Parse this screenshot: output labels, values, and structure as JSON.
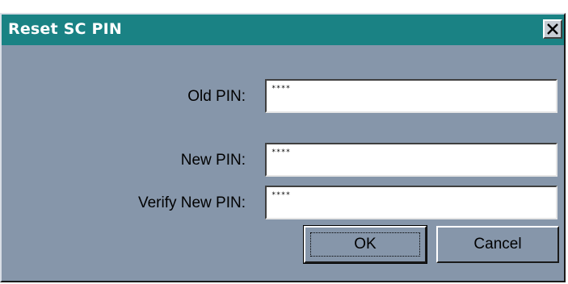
{
  "dialog": {
    "title": "Reset SC PIN",
    "close_icon": "close-icon"
  },
  "fields": {
    "old_pin": {
      "label": "Old PIN:",
      "value": "****"
    },
    "new_pin": {
      "label": "New PIN:",
      "value": "****"
    },
    "verify_pin": {
      "label": "Verify New PIN:",
      "value": "****"
    }
  },
  "buttons": {
    "ok_label": "OK",
    "cancel_label": "Cancel"
  },
  "colors": {
    "titlebar": "#1a8284",
    "dialog_bg": "#8696aa"
  }
}
